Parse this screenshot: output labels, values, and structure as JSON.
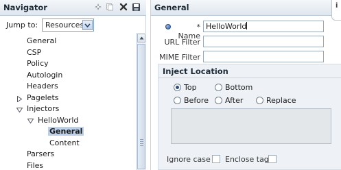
{
  "navigator": {
    "title": "Navigator",
    "toolbar_icons": [
      "add-icon",
      "copy-icon",
      "delete-icon",
      "save-icon"
    ],
    "jump_to": {
      "label": "Jump to:",
      "value": "Resources"
    },
    "tree": {
      "general": "General",
      "csp": "CSP",
      "policy": "Policy",
      "autologin": "Autologin",
      "headers": "Headers",
      "pagelets": "Pagelets",
      "injectors": "Injectors",
      "helloworld": "HelloWorld",
      "hw_general": "General",
      "hw_content": "Content",
      "parsers": "Parsers",
      "files": "Files"
    }
  },
  "detail": {
    "title": "General",
    "corner_mark": "i",
    "name": {
      "label": "* Name",
      "value": "HelloWorld"
    },
    "url_filter": {
      "label": "URL Filter",
      "value": ""
    },
    "mime_filter": {
      "label": "MIME Filter",
      "value": ""
    },
    "inject_location": {
      "title": "Inject Location",
      "options": {
        "top": "Top",
        "bottom": "Bottom",
        "before": "Before",
        "after": "After",
        "replace": "Replace"
      },
      "selected": "Top",
      "content": ""
    },
    "ignore_case": {
      "label": "Ignore case",
      "checked": false
    },
    "enclose_tag": {
      "label": "Enclose tag",
      "checked": false
    }
  },
  "colors": {
    "header_bg": "#dfe6ee",
    "selection_bg": "#bcd0ea",
    "section_bg": "#eef2f6",
    "required_dot": "#2e5ea9"
  }
}
